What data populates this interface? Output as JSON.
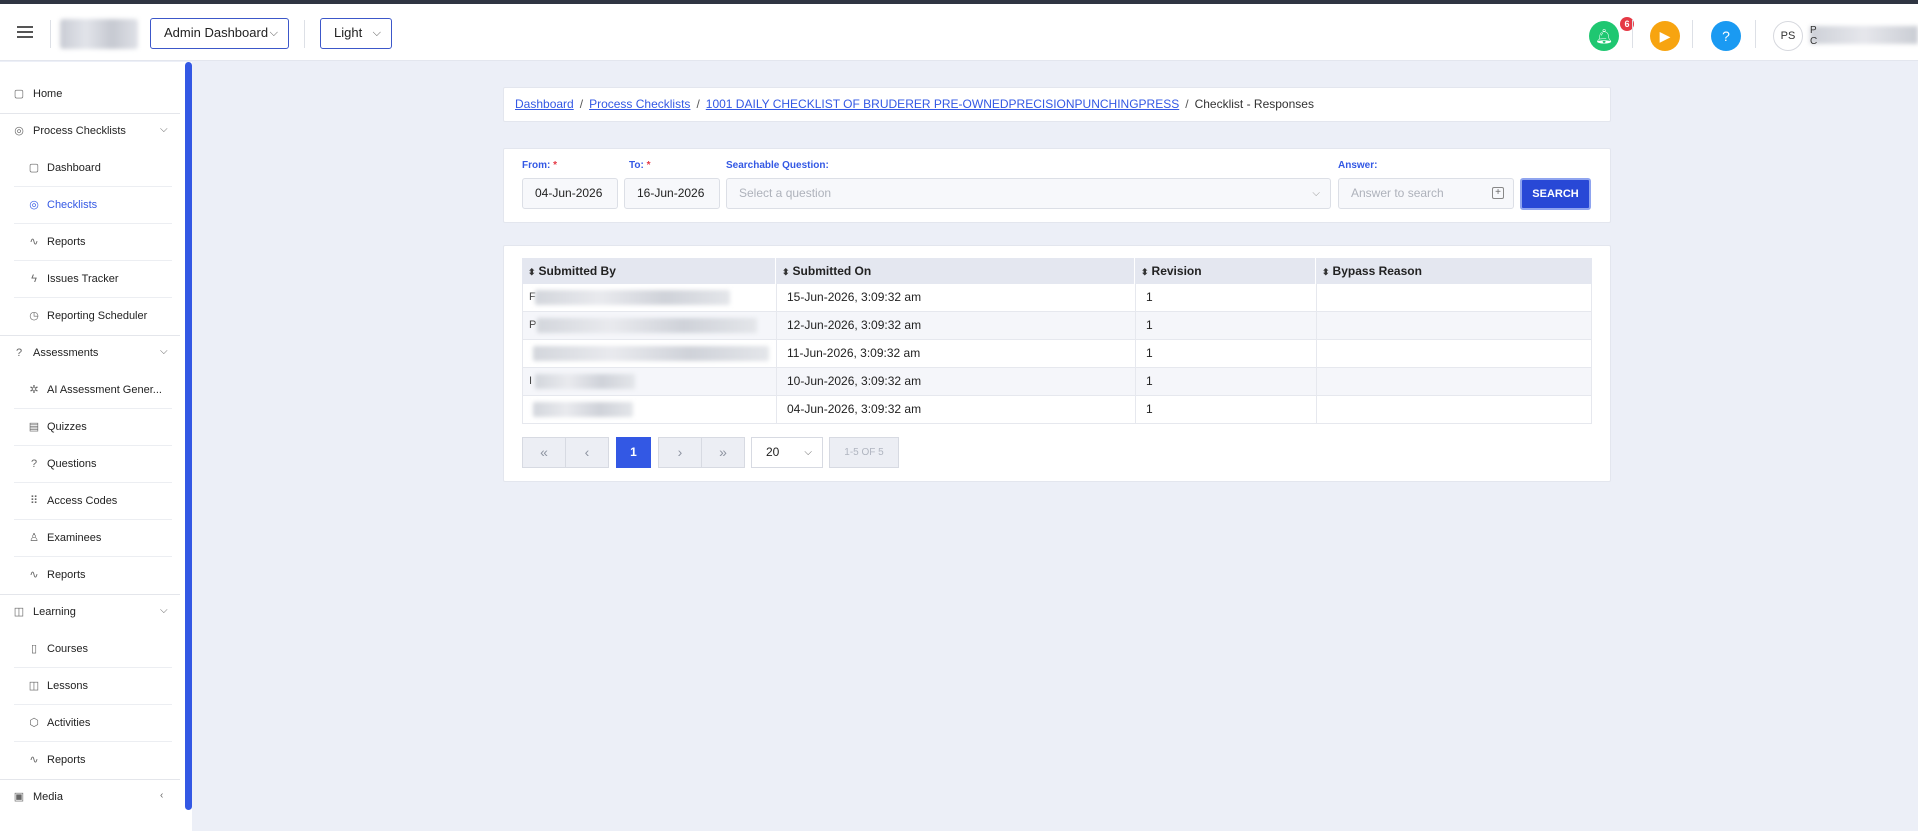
{
  "header": {
    "dashboard_select": "Admin Dashboard",
    "theme_select": "Light",
    "notification_count": "6",
    "help_label": "?",
    "avatar_initials": "PS",
    "user_letter_1": "P",
    "user_letter_2": "C"
  },
  "sidebar": {
    "home": "Home",
    "process_checklists": "Process Checklists",
    "pc_items": [
      "Dashboard",
      "Checklists",
      "Reports",
      "Issues Tracker",
      "Reporting Scheduler"
    ],
    "assessments": "Assessments",
    "as_items": [
      "AI Assessment Gener...",
      "Quizzes",
      "Questions",
      "Access Codes",
      "Examinees",
      "Reports"
    ],
    "learning": "Learning",
    "le_items": [
      "Courses",
      "Lessons",
      "Activities",
      "Reports"
    ],
    "media": "Media"
  },
  "breadcrumb": {
    "items": [
      "Dashboard",
      "Process Checklists",
      "1001 DAILY CHECKLIST OF BRUDERER PRE-OWNEDPRECISIONPUNCHINGPRESS"
    ],
    "current": "Checklist - Responses"
  },
  "filters": {
    "from_label": "From:",
    "to_label": "To:",
    "required_mark": "*",
    "from_value": "04-Jun-2026",
    "to_value": "16-Jun-2026",
    "question_label": "Searchable Question:",
    "question_placeholder": "Select a question",
    "answer_label": "Answer:",
    "answer_placeholder": "Answer to search",
    "search_button": "SEARCH"
  },
  "table": {
    "columns": [
      "Submitted By",
      "Submitted On",
      "Revision",
      "Bypass Reason"
    ],
    "rows": [
      {
        "initial": "F",
        "submitted_on": "15-Jun-2026, 3:09:32 am",
        "revision": "1",
        "bypass": ""
      },
      {
        "initial": "P",
        "submitted_on": "12-Jun-2026, 3:09:32 am",
        "revision": "1",
        "bypass": ""
      },
      {
        "initial": "",
        "submitted_on": "11-Jun-2026, 3:09:32 am",
        "revision": "1",
        "bypass": ""
      },
      {
        "initial": "I",
        "submitted_on": "10-Jun-2026, 3:09:32 am",
        "revision": "1",
        "bypass": ""
      },
      {
        "initial": "",
        "submitted_on": "04-Jun-2026, 3:09:32 am",
        "revision": "1",
        "bypass": ""
      }
    ]
  },
  "pagination": {
    "first": "«",
    "prev": "‹",
    "current_page": "1",
    "next": "›",
    "last": "»",
    "page_size": "20",
    "range_info": "1-5 OF 5"
  }
}
